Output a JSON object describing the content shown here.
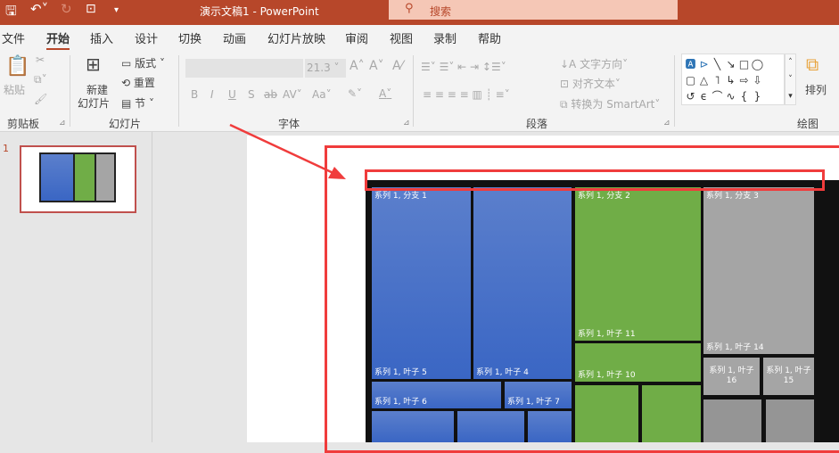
{
  "titlebar": {
    "title": "演示文稿1  -  PowerPoint",
    "search_placeholder": "搜索",
    "icons": [
      "save-icon",
      "undo-icon",
      "redo-icon",
      "present-icon",
      "customize-icon"
    ]
  },
  "tabs": [
    "文件",
    "开始",
    "插入",
    "设计",
    "切换",
    "动画",
    "幻灯片放映",
    "审阅",
    "视图",
    "录制",
    "帮助"
  ],
  "ribbon": {
    "clipboard": {
      "paste": "粘贴",
      "label": "剪贴板"
    },
    "slides": {
      "new_slide_1": "新建",
      "new_slide_2": "幻灯片",
      "layout": "版式",
      "reset": "重置",
      "section": "节",
      "label": "幻灯片"
    },
    "font": {
      "size": "21.3",
      "bold": "B",
      "italic": "I",
      "underline": "U",
      "shadow": "S",
      "strike": "ab",
      "spacing": "AV",
      "case": "Aa",
      "color": "A",
      "grow": "A",
      "shrink": "A",
      "label": "字体"
    },
    "paragraph": {
      "text_direction": "文字方向",
      "align_text": "对齐文本",
      "smartart": "转换为 SmartArt",
      "label": "段落"
    },
    "drawing": {
      "arrange": "排列",
      "label": "绘图"
    }
  },
  "thumbnail": {
    "number": "1"
  },
  "chart": {
    "branch1": "系列 1, 分支 1",
    "branch2": "系列 1, 分支 2",
    "branch3": "系列 1, 分支 3",
    "leaf5": "系列 1, 叶子 5",
    "leaf4": "系列 1, 叶子 4",
    "leaf6": "系列 1, 叶子 6",
    "leaf7": "系列 1, 叶子 7",
    "leaf11": "系列 1, 叶子 11",
    "leaf10": "系列 1, 叶子 10",
    "leaf14": "系列 1, 叶子 14",
    "leaf16a": "系列 1, 叶子",
    "leaf16b": "16",
    "leaf15a": "系列 1, 叶子",
    "leaf15b": "15"
  },
  "colors": {
    "accent": "#b7472a",
    "blue": "#4472c4",
    "green": "#70ad47",
    "gray": "#a5a5a5",
    "highlight": "#f03c3c"
  }
}
